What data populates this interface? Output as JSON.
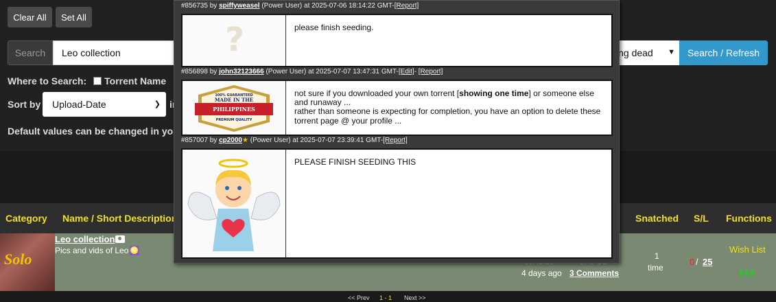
{
  "toolbar": {
    "clear_all": "Clear All",
    "set_all": "Set All"
  },
  "search": {
    "label": "Search",
    "value": "Leo collection",
    "filter_value": "ing dead",
    "button": "Search / Refresh"
  },
  "where": {
    "label": "Where to Search:",
    "option_torrent_name": "Torrent Name"
  },
  "sort": {
    "label": "Sort by",
    "value": "Upload-Date",
    "in_fragment": "in"
  },
  "defaults_note": "Default values can be changed in you",
  "table": {
    "headers": [
      "Category",
      "Name / Short Description",
      "Snatched",
      "S/L",
      "Functions"
    ],
    "row": {
      "thumb_text": "Solo",
      "name": "Leo collection",
      "desc": "Pics and vids of Leo",
      "leo_symbol": "♌",
      "duration_faded": "06:42:20",
      "size_faded": "9.45 GB",
      "ago": "4 days ago",
      "comments": "3 Comments",
      "snatched_num": "1",
      "snatched_unit": "time",
      "seeders": "0",
      "slash": "/",
      "leechers": "25",
      "wish": "Wish List"
    }
  },
  "pager": {
    "prev": "<< Prev",
    "page": "1 - 1",
    "next": "Next >>"
  },
  "comments": [
    {
      "id": "#856735",
      "by": "by",
      "user": "spiffyweasel",
      "role": "(Power User)",
      "at": "at 2025-07-06 18:14:22 GMT-",
      "links": [
        "[Report]"
      ],
      "text": [
        "please finish seeding."
      ],
      "avatar": "question-mark"
    },
    {
      "id": "#856898",
      "by": "by",
      "user": "john32123666",
      "role": "(Power User)",
      "at": "at 2025-07-07 13:47:31 GMT-",
      "links": [
        "[Edit]",
        "- ",
        "[Report]"
      ],
      "text_pre": "not sure if you downloaded your own torrent  [",
      "text_bold": "showing one time",
      "text_post": "] or someone else and runaway ...",
      "text2": "rather than someone is expecting for completion, you have an option to delete these torrent page @ your profile ...",
      "avatar_seal": {
        "top": "100% GUARANTEED",
        "mid1": "MADE IN THE",
        "mid2": "PHILIPPINES",
        "bottom": "PREMIUM QUALITY"
      }
    },
    {
      "id": "#857007",
      "by": "by",
      "user": "cp2000",
      "role": "(Power User)",
      "at": "at 2025-07-07 23:39:41 GMT-",
      "links": [
        "[Report]"
      ],
      "text": [
        "PLEASE FINISH SEEDING THIS"
      ],
      "avatar": "angel"
    }
  ]
}
